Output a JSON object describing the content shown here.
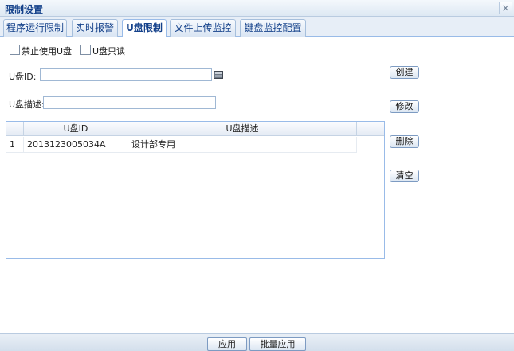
{
  "window": {
    "title": "限制设置",
    "close_label": "×"
  },
  "tabs": [
    {
      "label": "程序运行限制"
    },
    {
      "label": "实时报警"
    },
    {
      "label": "U盘限制"
    },
    {
      "label": "文件上传监控"
    },
    {
      "label": "键盘监控配置"
    }
  ],
  "active_tab": "U盘限制",
  "options": {
    "disable_usb": {
      "label": "禁止使用U盘",
      "checked": false
    },
    "usb_readonly": {
      "label": "U盘只读",
      "checked": false
    }
  },
  "form": {
    "usb_id_label": "U盘ID:",
    "usb_id_value": "",
    "usb_desc_label": "U盘描述:",
    "usb_desc_value": ""
  },
  "actions": {
    "create": "创建",
    "modify": "修改",
    "delete": "删除",
    "clear": "清空"
  },
  "grid": {
    "columns": [
      "",
      "U盘ID",
      "U盘描述"
    ],
    "rows": [
      {
        "num": "1",
        "id": "2013123005034A",
        "desc": "设计部专用"
      }
    ]
  },
  "footer": {
    "apply": "应用",
    "batch_apply": "批量应用"
  }
}
